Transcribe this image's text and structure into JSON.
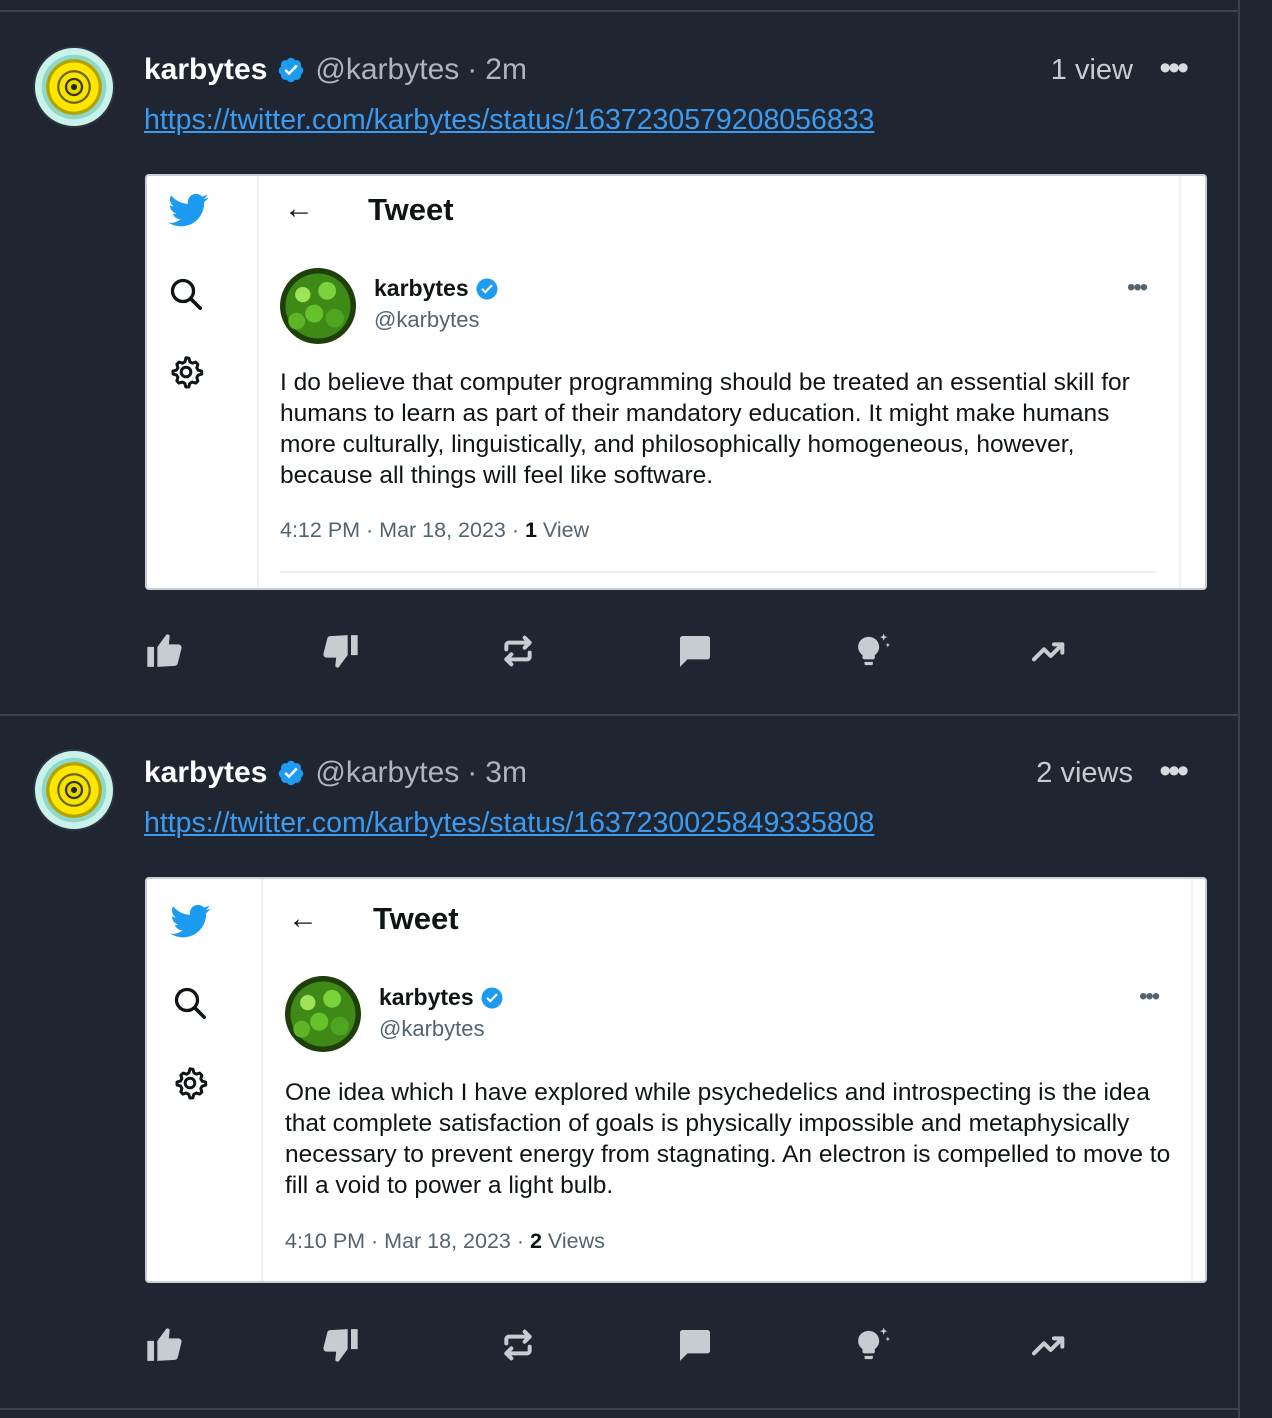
{
  "posts": [
    {
      "author": "karbytes",
      "handle": "@karbytes",
      "separator": "·",
      "time": "2m",
      "views": "1 view",
      "link": "https://twitter.com/karbytes/status/1637230579208056833",
      "screenshot": {
        "page_title": "Tweet",
        "name": "karbytes",
        "handle": "@karbytes",
        "text": "I do believe that computer programming should be treated an essential skill for humans to learn as part of their mandatory education. It might make humans more culturally, linguistically, and philosophically homogeneous, however, because all things will feel like software.",
        "meta_time": "4:12 PM · Mar 18, 2023 · ",
        "meta_count": "1",
        "meta_label": " View"
      }
    },
    {
      "author": "karbytes",
      "handle": "@karbytes",
      "separator": "·",
      "time": "3m",
      "views": "2 views",
      "link": "https://twitter.com/karbytes/status/1637230025849335808",
      "screenshot": {
        "page_title": "Tweet",
        "name": "karbytes",
        "handle": "@karbytes",
        "text": "One idea which I have explored while psychedelics and introspecting is the idea that complete satisfaction of goals is physically impossible and metaphysically necessary to prevent energy from stagnating. An electron is compelled to move to fill a void to power a light bulb.",
        "meta_time": "4:10 PM · Mar 18, 2023 · ",
        "meta_count": "2",
        "meta_label": " Views"
      }
    }
  ],
  "icons": {
    "like": "thumbs-up-icon",
    "dislike": "thumbs-down-icon",
    "repost": "repost-icon",
    "comment": "comment-icon",
    "insight": "lightbulb-icon",
    "boost": "trending-icon",
    "more": "more-icon",
    "verified": "verified-badge-icon"
  },
  "colors": {
    "background": "#1f2632",
    "link": "#3a9bf0",
    "verified": "#1d9bf0",
    "icon": "#c7ccd3"
  }
}
